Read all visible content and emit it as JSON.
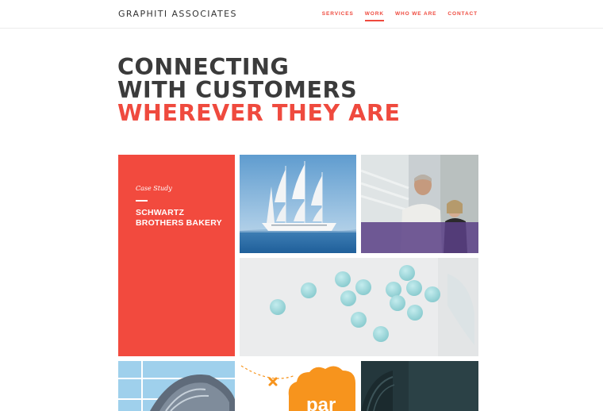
{
  "header": {
    "logo": "GRAPHITI ASSOCIATES",
    "nav": [
      {
        "label": "SERVICES",
        "active": false
      },
      {
        "label": "WORK",
        "active": true
      },
      {
        "label": "WHO WE ARE",
        "active": false
      },
      {
        "label": "CONTACT",
        "active": false
      }
    ]
  },
  "hero": {
    "line1": "CONNECTING",
    "line2": "WITH CUSTOMERS",
    "line3": "WHEREVER THEY ARE"
  },
  "case_study": {
    "label": "Case Study",
    "title": "SCHWARTZ BROTHERS BAKERY"
  },
  "orange_tile": {
    "fragment": "par"
  },
  "colors": {
    "accent": "#ef4a3e",
    "case_bg": "#f24a3e",
    "text_dark": "#3b3b3b",
    "orange": "#f7941d",
    "purple": "#5a3f86",
    "pill": "#9fd6d9"
  },
  "images": [
    "sailing-ship-photo",
    "smiling-couple-photo",
    "blue-pills-photo",
    "building-facade-photo",
    "orange-badge-graphic",
    "dark-teal-photo"
  ]
}
